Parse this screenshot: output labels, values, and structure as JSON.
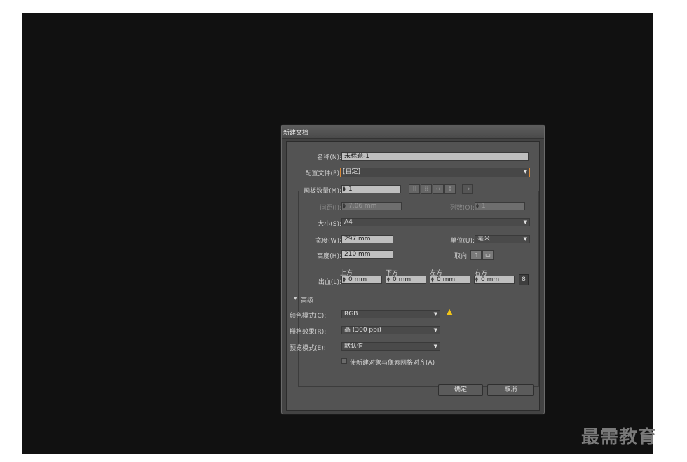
{
  "dialog": {
    "title": "新建文档",
    "name_label": "名称(N):",
    "name_value": "未标题-1",
    "profile_label": "配置文件(P):",
    "profile_value": "[自定]",
    "artboards_label": "画板数量(M):",
    "artboards_value": "1",
    "spacing_label": "间距(I):",
    "spacing_value": "7.06 mm",
    "columns_label": "列数(O):",
    "columns_value": "1",
    "size_label": "大小(S):",
    "size_value": "A4",
    "width_label": "宽度(W):",
    "width_value": "297 mm",
    "units_label": "单位(U):",
    "units_value": "毫米",
    "height_label": "高度(H):",
    "height_value": "210 mm",
    "orientation_label": "取向:",
    "bleed_label": "出血(L):",
    "bleed_top_label": "上方",
    "bleed_bottom_label": "下方",
    "bleed_left_label": "左方",
    "bleed_right_label": "右方",
    "bleed_top": "0 mm",
    "bleed_bottom": "0 mm",
    "bleed_left": "0 mm",
    "bleed_right": "0 mm",
    "advanced_label": "高级",
    "color_mode_label": "颜色模式(C):",
    "color_mode_value": "RGB",
    "raster_label": "栅格效果(R):",
    "raster_value": "高 (300 ppi)",
    "preview_label": "预览模式(E):",
    "preview_value": "默认值",
    "align_pixel_label": "使新建对象与像素网格对齐(A)",
    "ok_label": "确定",
    "cancel_label": "取消"
  },
  "watermark": "最需教育"
}
